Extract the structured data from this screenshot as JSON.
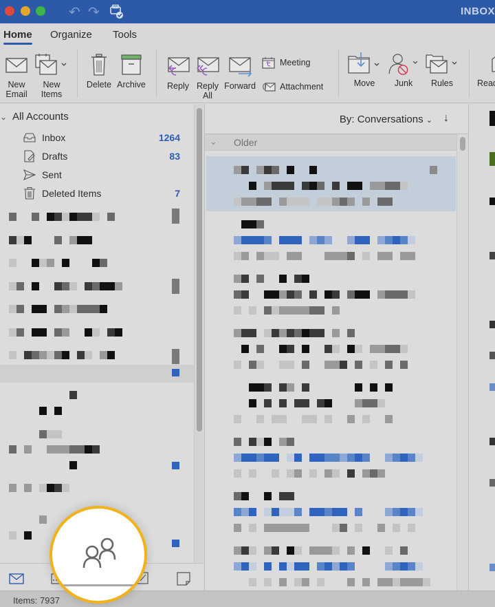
{
  "window": {
    "title": "INBOX",
    "controls": [
      "close",
      "minimize",
      "maximize"
    ],
    "toolbar_icons": [
      "undo-icon",
      "redo-icon",
      "sync-printer-icon"
    ]
  },
  "tabs": [
    {
      "label": "Home",
      "active": true
    },
    {
      "label": "Organize",
      "active": false
    },
    {
      "label": "Tools",
      "active": false
    }
  ],
  "ribbon": {
    "new_email": "New\nEmail",
    "new_email_l1": "New",
    "new_email_l2": "Email",
    "new_items_l1": "New",
    "new_items_l2": "Items",
    "delete": "Delete",
    "archive": "Archive",
    "reply": "Reply",
    "reply_all_l1": "Reply",
    "reply_all_l2": "All",
    "forward": "Forward",
    "meeting": "Meeting",
    "attachment": "Attachment",
    "move": "Move",
    "junk": "Junk",
    "rules": "Rules",
    "read_partial": "Read"
  },
  "folders": {
    "account_label": "All Accounts",
    "items": [
      {
        "label": "Inbox",
        "count": "1264",
        "icon": "inbox-icon"
      },
      {
        "label": "Drafts",
        "count": "83",
        "icon": "drafts-icon"
      },
      {
        "label": "Sent",
        "count": "",
        "icon": "sent-icon"
      },
      {
        "label": "Deleted Items",
        "count": "7",
        "icon": "trash-icon"
      }
    ]
  },
  "message_list": {
    "sort_label": "By: Conversations",
    "sort_direction": "descending",
    "group_label": "Older"
  },
  "bottom_nav": [
    "mail-icon",
    "calendar-icon",
    "people-icon",
    "tasks-icon",
    "notes-icon"
  ],
  "highlighted_nav": "people",
  "status": {
    "items_label": "Items: 7937"
  },
  "colors": {
    "titlebar": "#2c5aa8",
    "accent": "#2f5bb0",
    "highlight_ring": "#f2b21c",
    "selected_row": "#c3cedb"
  }
}
